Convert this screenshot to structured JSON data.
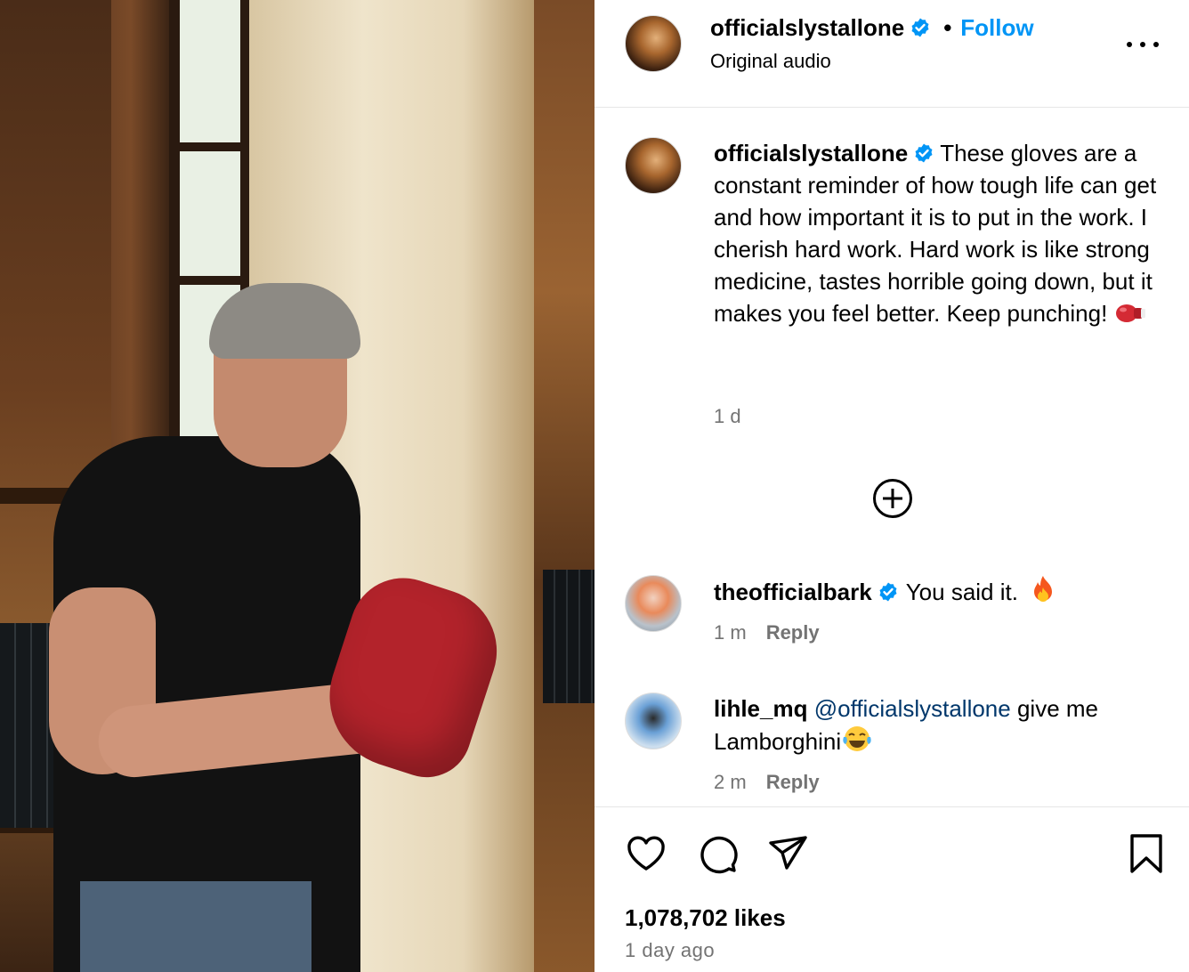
{
  "post": {
    "author": "officialslystallone",
    "follow_label": "Follow",
    "header_separator": "•",
    "audio_label": "Original audio"
  },
  "caption": {
    "author": "officialslystallone",
    "text": "These gloves are a constant reminder of how tough life can get and how important it is to put in the work. I cherish hard work. Hard work is like strong medicine, tastes horrible going down, but it makes you feel better. Keep punching!",
    "time": "1 d"
  },
  "comments": [
    {
      "author": "theofficialbark",
      "text": "You said it.",
      "time": "1 m",
      "reply_label": "Reply"
    },
    {
      "author": "lihle_mq",
      "mention": "@officialslystallone",
      "text": "give me Lamborghini",
      "time": "2 m",
      "reply_label": "Reply"
    }
  ],
  "footer": {
    "likes": "1,078,702 likes",
    "posted": "1 day ago"
  },
  "icons": {
    "verified": "verified-badge-icon",
    "more": "more-options-icon",
    "add": "add-circle-icon",
    "like": "heart-icon",
    "comment": "comment-icon",
    "share": "send-icon",
    "save": "bookmark-icon",
    "boxing_glove": "boxing-glove-emoji",
    "fire": "fire-emoji",
    "laugh": "tears-of-joy-emoji"
  },
  "colors": {
    "accent": "#0095f6",
    "verified": "#0095f6",
    "mention": "#00376b",
    "secondary_text": "#737373",
    "divider": "#e6e6e6"
  }
}
